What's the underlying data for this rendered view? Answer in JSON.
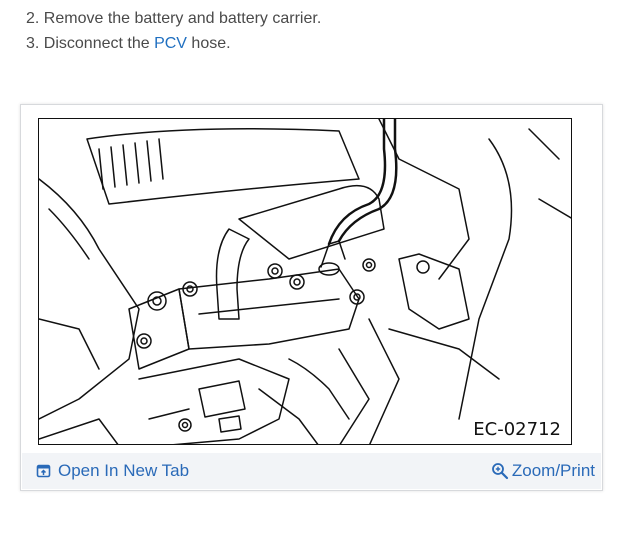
{
  "steps": {
    "step2": "2. Remove the battery and battery carrier.",
    "step3_prefix": "3. Disconnect the ",
    "step3_link": "PCV",
    "step3_suffix": " hose."
  },
  "figure": {
    "code": "EC-02712"
  },
  "footer": {
    "open_new_tab": "Open In New Tab",
    "zoom_print": "Zoom/Print"
  },
  "icons": {
    "open_tab": "open-in-new-tab-icon",
    "zoom": "magnifier-icon"
  },
  "colors": {
    "link": "#1f6fc0",
    "footer_link": "#2a6ab8",
    "footer_bg": "#f2f4f7",
    "text": "#4a4a4a"
  }
}
